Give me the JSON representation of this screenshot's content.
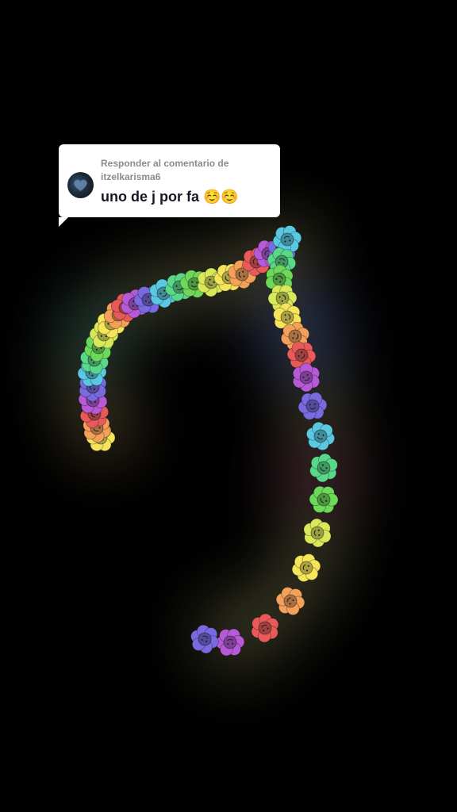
{
  "reply_card": {
    "prefix": "Responder al comentario de",
    "username": "itzelkarisma6",
    "comment": "uno de j por fa ☺️☺️"
  },
  "flower_colors": [
    "#f6e55a",
    "#f3a05a",
    "#e85a5a",
    "#b65ad8",
    "#7a6ae0",
    "#5ac8e0",
    "#5ad88a",
    "#6ed85a",
    "#d8e85a"
  ]
}
